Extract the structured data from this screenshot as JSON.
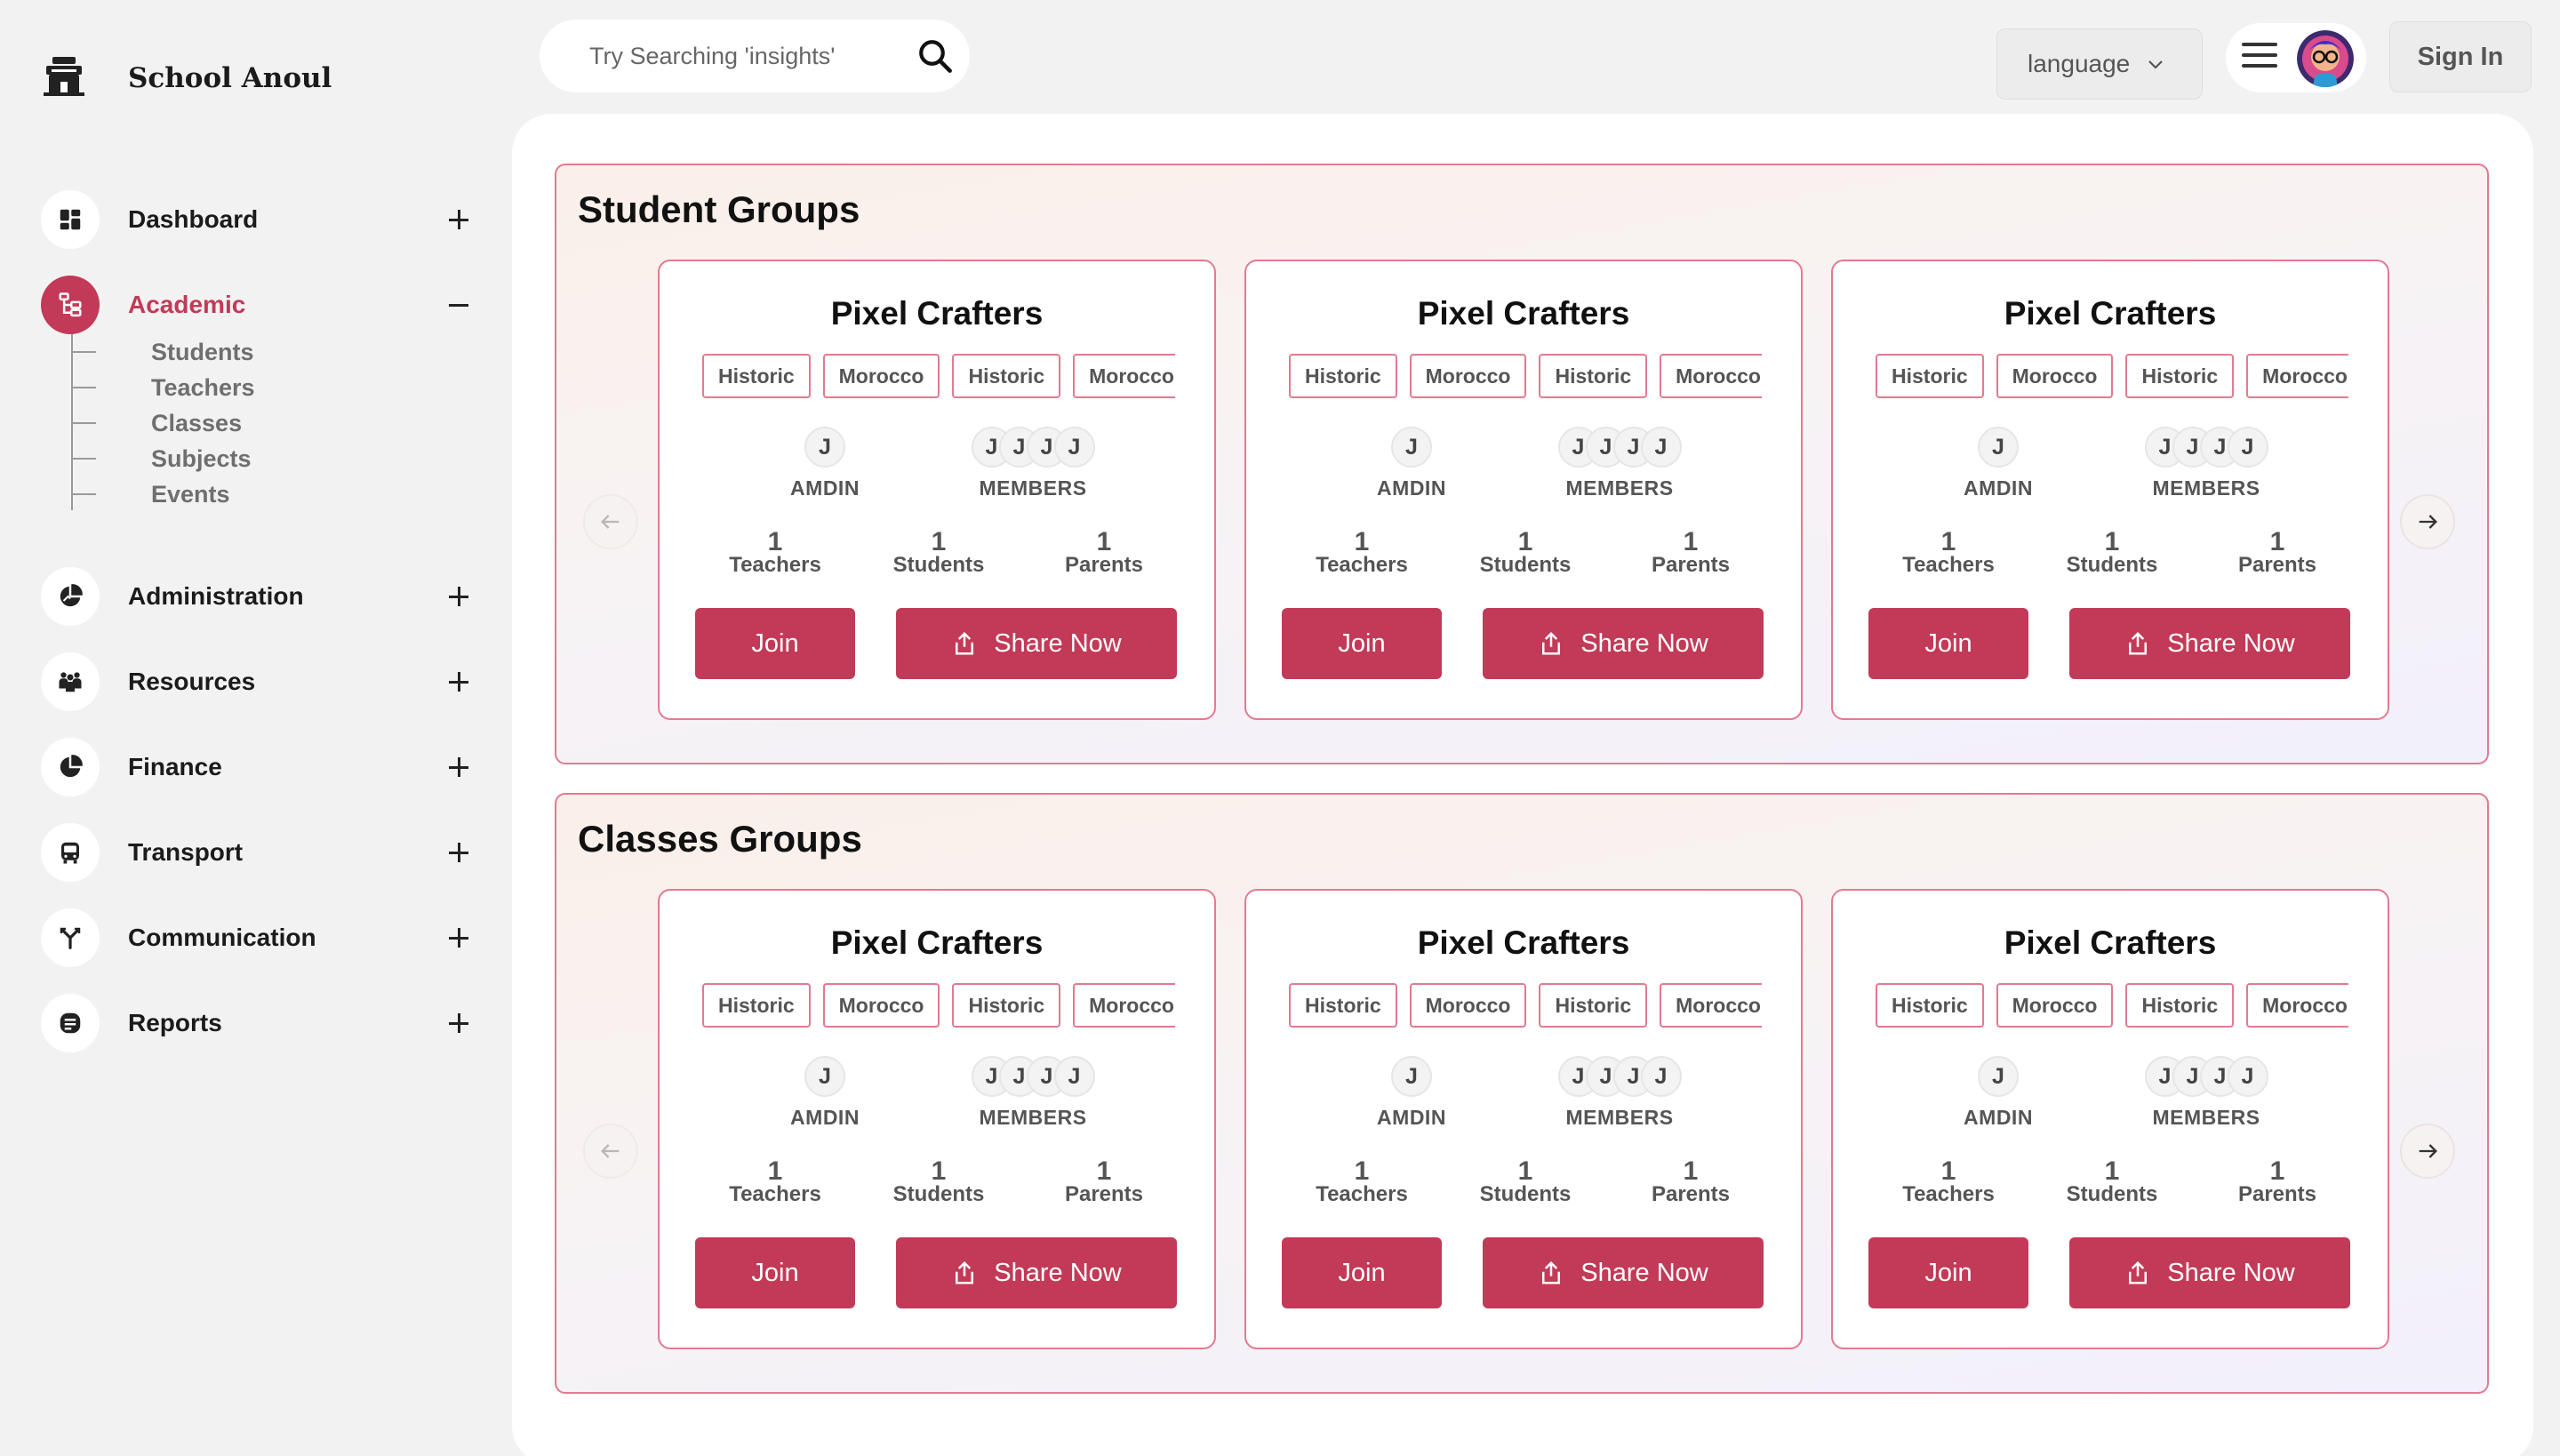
{
  "brand": {
    "name": "School Anoul",
    "logo_icon": "school-logo-icon"
  },
  "sidebar": {
    "items": [
      {
        "label": "Dashboard",
        "icon": "dashboard-grid-icon",
        "toggle": "plus"
      },
      {
        "label": "Academic",
        "icon": "academic-tree-icon",
        "toggle": "minus",
        "active": true,
        "children": [
          "Students",
          "Teachers",
          "Classes",
          "Subjects",
          "Events"
        ]
      },
      {
        "label": "Administration",
        "icon": "administration-pie-icon",
        "toggle": "plus"
      },
      {
        "label": "Resources",
        "icon": "resources-people-icon",
        "toggle": "plus"
      },
      {
        "label": "Finance",
        "icon": "finance-pie-icon",
        "toggle": "plus"
      },
      {
        "label": "Transport",
        "icon": "bus-icon",
        "toggle": "plus"
      },
      {
        "label": "Communication",
        "icon": "communication-branch-icon",
        "toggle": "plus"
      },
      {
        "label": "Reports",
        "icon": "reports-document-icon",
        "toggle": "plus"
      }
    ]
  },
  "header": {
    "search_placeholder": "Try Searching 'insights'",
    "language_label": "language",
    "signin_label": "Sign In"
  },
  "groups": [
    {
      "title": "Student Groups",
      "cards": [
        {
          "title": "Pixel Crafters",
          "tags": [
            "Historic",
            "Morocco",
            "Historic",
            "Morocco"
          ],
          "admin_initial": "J",
          "admin_label": "AMDIN",
          "member_initials": [
            "J",
            "J",
            "J",
            "J"
          ],
          "members_label": "MEMBERS",
          "stats": [
            {
              "num": "1",
              "label": "Teachers"
            },
            {
              "num": "1",
              "label": "Students"
            },
            {
              "num": "1",
              "label": "Parents"
            }
          ],
          "join_label": "Join",
          "share_label": "Share Now"
        },
        {
          "title": "Pixel Crafters",
          "tags": [
            "Historic",
            "Morocco",
            "Historic",
            "Morocco"
          ],
          "admin_initial": "J",
          "admin_label": "AMDIN",
          "member_initials": [
            "J",
            "J",
            "J",
            "J"
          ],
          "members_label": "MEMBERS",
          "stats": [
            {
              "num": "1",
              "label": "Teachers"
            },
            {
              "num": "1",
              "label": "Students"
            },
            {
              "num": "1",
              "label": "Parents"
            }
          ],
          "join_label": "Join",
          "share_label": "Share Now"
        },
        {
          "title": "Pixel Crafters",
          "tags": [
            "Historic",
            "Morocco",
            "Historic",
            "Morocco"
          ],
          "admin_initial": "J",
          "admin_label": "AMDIN",
          "member_initials": [
            "J",
            "J",
            "J",
            "J"
          ],
          "members_label": "MEMBERS",
          "stats": [
            {
              "num": "1",
              "label": "Teachers"
            },
            {
              "num": "1",
              "label": "Students"
            },
            {
              "num": "1",
              "label": "Parents"
            }
          ],
          "join_label": "Join",
          "share_label": "Share Now"
        }
      ]
    },
    {
      "title": "Classes Groups",
      "cards": [
        {
          "title": "Pixel Crafters",
          "tags": [
            "Historic",
            "Morocco",
            "Historic",
            "Morocco"
          ],
          "admin_initial": "J",
          "admin_label": "AMDIN",
          "member_initials": [
            "J",
            "J",
            "J",
            "J"
          ],
          "members_label": "MEMBERS",
          "stats": [
            {
              "num": "1",
              "label": "Teachers"
            },
            {
              "num": "1",
              "label": "Students"
            },
            {
              "num": "1",
              "label": "Parents"
            }
          ],
          "join_label": "Join",
          "share_label": "Share Now"
        },
        {
          "title": "Pixel Crafters",
          "tags": [
            "Historic",
            "Morocco",
            "Historic",
            "Morocco"
          ],
          "admin_initial": "J",
          "admin_label": "AMDIN",
          "member_initials": [
            "J",
            "J",
            "J",
            "J"
          ],
          "members_label": "MEMBERS",
          "stats": [
            {
              "num": "1",
              "label": "Teachers"
            },
            {
              "num": "1",
              "label": "Students"
            },
            {
              "num": "1",
              "label": "Parents"
            }
          ],
          "join_label": "Join",
          "share_label": "Share Now"
        },
        {
          "title": "Pixel Crafters",
          "tags": [
            "Historic",
            "Morocco",
            "Historic",
            "Morocco"
          ],
          "admin_initial": "J",
          "admin_label": "AMDIN",
          "member_initials": [
            "J",
            "J",
            "J",
            "J"
          ],
          "members_label": "MEMBERS",
          "stats": [
            {
              "num": "1",
              "label": "Teachers"
            },
            {
              "num": "1",
              "label": "Students"
            },
            {
              "num": "1",
              "label": "Parents"
            }
          ],
          "join_label": "Join",
          "share_label": "Share Now"
        }
      ]
    }
  ],
  "colors": {
    "accent": "#c23a57",
    "border_pink": "#e27a90",
    "page_bg": "#f3f2f2"
  }
}
